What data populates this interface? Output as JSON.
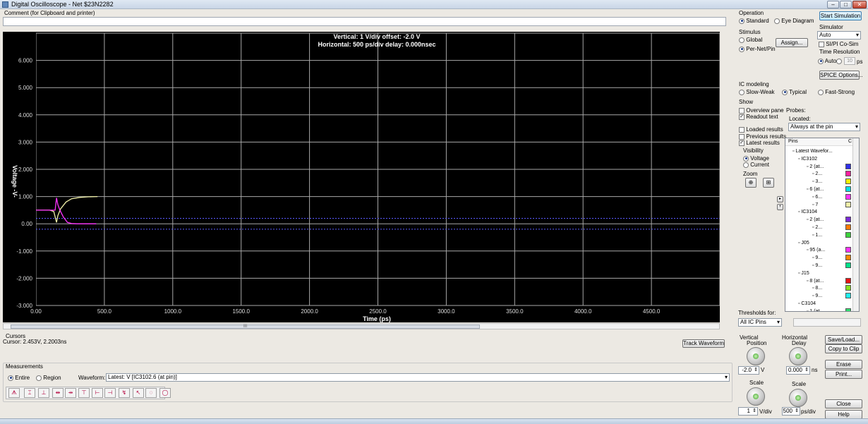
{
  "window": {
    "title": "Digital Oscilloscope - Net $23N2282",
    "min_label": "–",
    "max_label": "□",
    "close_label": "✕"
  },
  "comment": {
    "label": "Comment (for Clipboard and printer)",
    "value": ""
  },
  "scope": {
    "header_line1": "Vertical: 1  V/div  offset: -2.0 V",
    "header_line2": "Horizontal: 500 ps/div  delay: 0.000nsec",
    "y_axis_title": "Voltage  -V-",
    "x_axis_title": "Time  (ps)",
    "y_ticks": [
      "6.000",
      "5.000",
      "4.000",
      "3.000",
      "2.000",
      "1.000",
      "0.00",
      "-1.000",
      "-2.000",
      "-3.000"
    ],
    "x_ticks": [
      "0.00",
      "500.0",
      "1000.0",
      "1500.0",
      "2000.0",
      "2500.0",
      "3000.0",
      "3500.0",
      "4000.0",
      "4500.0"
    ],
    "scroll_center_label": "III",
    "colors": {
      "grid": "#a8a8a8",
      "yellow_trace": "#f0f0a8",
      "magenta_trace": "#ff33ff",
      "threshold": "#5a5aff"
    }
  },
  "chart_data": {
    "type": "line",
    "xlabel": "Time  (ps)",
    "ylabel": "Voltage  -V-",
    "xlim": [
      0,
      5000
    ],
    "ylim": [
      -3,
      7
    ],
    "grid": true,
    "series": [
      {
        "color": "#f0f0a8",
        "x": [
          0,
          40,
          100,
          130,
          150,
          160,
          180,
          220,
          260,
          320,
          380,
          450
        ],
        "y": [
          0.5,
          0.5,
          0.5,
          0.45,
          0.05,
          0.3,
          0.55,
          0.8,
          0.92,
          0.97,
          0.99,
          1.0
        ]
      },
      {
        "color": "#ff33ff",
        "x": [
          0,
          40,
          100,
          140,
          150,
          160,
          175,
          200,
          230,
          260,
          300,
          360,
          440
        ],
        "y": [
          0.5,
          0.5,
          0.5,
          0.5,
          0.95,
          0.7,
          0.5,
          0.25,
          0.05,
          0.01,
          0.0,
          0.0,
          0.0
        ]
      }
    ],
    "thresholds": [
      0.2,
      -0.2
    ]
  },
  "operation": {
    "label": "Operation",
    "standard": "Standard",
    "eye": "Eye Diagram"
  },
  "start_sim": "Start Simulation",
  "simulator": {
    "label": "Simulator",
    "value": "Auto",
    "co_sim": "SI/PI Co-Sim",
    "time_res_label": "Time Resolution",
    "auto": "Auto",
    "res_value": "10",
    "res_unit": "ps"
  },
  "stimulus": {
    "label": "Stimulus",
    "global": "Global",
    "per_net": "Per-Net/Pin",
    "assign": "Assign..."
  },
  "spice_options": "SPICE Options...",
  "ic_modeling": {
    "label": "IC modeling",
    "slow": "Slow-Weak",
    "typical": "Typical",
    "fast": "Fast-Strong"
  },
  "show": {
    "label": "Show",
    "overview": "Overview pane",
    "readout": "Readout text",
    "loaded": "Loaded results",
    "previous": "Previous results",
    "latest": "Latest results",
    "visibility": "Visibility",
    "voltage": "Voltage",
    "current": "Current",
    "zoom": "Zoom"
  },
  "probes": {
    "label": "Probes:",
    "located_label": "Located:",
    "located_value": "Always at the pin"
  },
  "tree": {
    "pins_header": "Pins",
    "header_right": "C",
    "rows": [
      {
        "text": "Latest Wavefor...",
        "swatch": ""
      },
      {
        "text": "IC3102",
        "swatch": ""
      },
      {
        "text": "2 (at...",
        "swatch": "#3030e8"
      },
      {
        "text": "2...",
        "swatch": "#ff1fa0"
      },
      {
        "text": "3...",
        "swatch": "#f4f400"
      },
      {
        "text": "6 (at...",
        "swatch": "#00e0e8"
      },
      {
        "text": "6...",
        "swatch": "#ff33ff"
      },
      {
        "text": "7",
        "swatch": "#f0f0a8"
      },
      {
        "text": "IC3104",
        "swatch": ""
      },
      {
        "text": "2 (at...",
        "swatch": "#7a2ad8"
      },
      {
        "text": "2...",
        "swatch": "#ff7a00"
      },
      {
        "text": "1...",
        "swatch": "#3cd23c"
      },
      {
        "text": "J05",
        "swatch": ""
      },
      {
        "text": "95 (a...",
        "swatch": "#ff33ff"
      },
      {
        "text": "9...",
        "swatch": "#ff8800"
      },
      {
        "text": "9...",
        "swatch": "#00e08a"
      },
      {
        "text": "J15",
        "swatch": ""
      },
      {
        "text": "8 (at...",
        "swatch": "#e81414"
      },
      {
        "text": "8...",
        "swatch": "#88e020"
      },
      {
        "text": "9...",
        "swatch": "#20f0f0"
      },
      {
        "text": "C3104",
        "swatch": ""
      },
      {
        "text": "1 (at",
        "swatch": "#30e070"
      }
    ]
  },
  "thresholds": {
    "label": "Thresholds for:",
    "value": "All IC Pins"
  },
  "cursors": {
    "label": "Cursors",
    "readout": "Cursor: 2.453V, 2.2003ns",
    "track": "Track Waveform"
  },
  "vertical": {
    "label1": "Vertical",
    "label2": "Position",
    "position": "-2.0",
    "unit": "V",
    "scale_label": "Scale",
    "scale": "1",
    "scale_unit": "V/div"
  },
  "horizontal": {
    "label1": "Horizontal",
    "label2": "Delay",
    "delay": "0.000",
    "unit": "ns",
    "scale_label": "Scale",
    "scale": "500",
    "scale_unit": "ps/div"
  },
  "buttons": {
    "save_load": "Save/Load...",
    "copy_clip": "Copy to Clip",
    "erase": "Erase",
    "print": "Print...",
    "close": "Close",
    "help": "Help"
  },
  "measurements": {
    "label": "Measurements",
    "entire": "Entire",
    "region": "Region",
    "waveform_label": "Waveform:",
    "waveform_value": "Latest: V [IC3102.6 (at pin)]"
  },
  "toolbar": [
    "ᗑ",
    "⌶",
    "⊥",
    "⇹",
    "⇸",
    "⊤",
    "⊢",
    "⊣",
    "↯",
    "↖",
    "◌",
    "◯"
  ]
}
